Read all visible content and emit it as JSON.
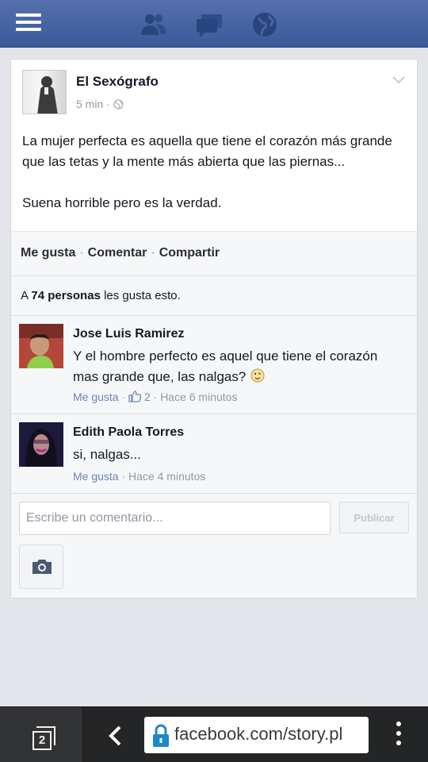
{
  "topbar": {
    "icons": [
      "menu-icon",
      "friend-requests-icon",
      "messages-icon",
      "notifications-globe-icon"
    ],
    "accent_color": "#3b5998"
  },
  "post": {
    "author": "El Sexógrafo",
    "time": "5 min",
    "privacy_separator": "·",
    "text_line_1": "La mujer perfecta es aquella que tiene el corazón más grande que las tetas y la mente más abierta que las piernas...",
    "text_line_2": "Suena horrible pero es la verdad."
  },
  "actions": {
    "like": "Me gusta",
    "comment": "Comentar",
    "share": "Compartir",
    "separator": "·"
  },
  "likes_summary": {
    "prefix": "A",
    "count": "74 personas",
    "suffix": "les gusta esto."
  },
  "comments": [
    {
      "author": "Jose Luis Ramirez",
      "text": "Y el hombre perfecto es aquel que tiene el corazón mas grande que, las nalgas?",
      "like_label": "Me gusta",
      "like_count": "2",
      "time": "Hace 6 minutos"
    },
    {
      "author": "Edith Paola Torres",
      "text": "si, nalgas...",
      "like_label": "Me gusta",
      "time": "Hace 4 minutos"
    }
  ],
  "composer": {
    "placeholder": "Escribe un comentario...",
    "publish_label": "Publicar"
  },
  "browser": {
    "tab_count": "2",
    "url": "facebook.com/story.pl"
  }
}
